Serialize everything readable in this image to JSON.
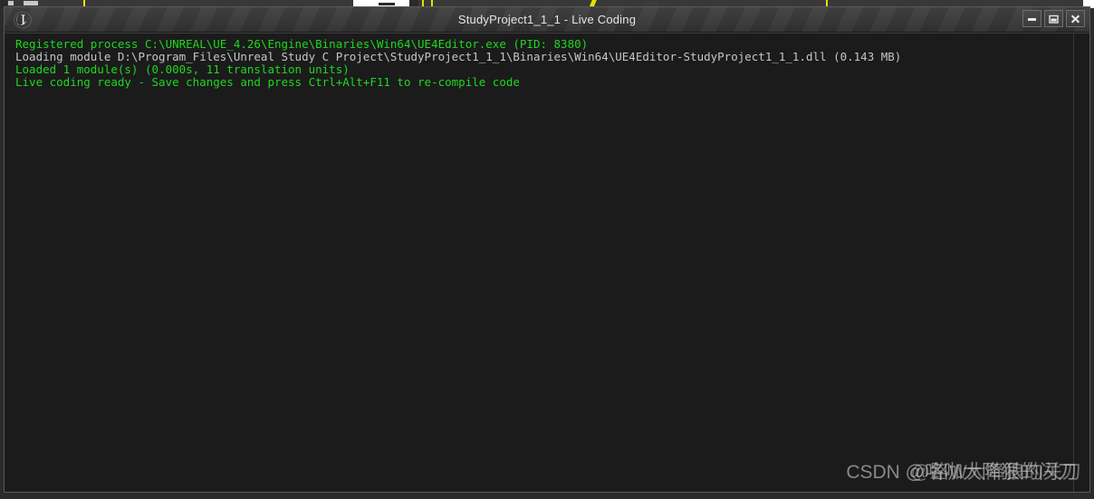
{
  "window": {
    "title": "StudyProject1_1_1 - Live Coding",
    "logo_icon": "unreal-engine-logo-icon",
    "controls": [
      {
        "name": "minimize",
        "icon": "minimize-icon",
        "label": "Minimize"
      },
      {
        "name": "maximize",
        "icon": "maximize-icon",
        "label": "Maximize"
      },
      {
        "name": "close",
        "icon": "close-icon",
        "label": "Close"
      }
    ]
  },
  "console": {
    "lines": [
      {
        "text": "Registered process C:\\UNREAL\\UE_4.26\\Engine\\Binaries\\Win64\\UE4Editor.exe (PID: 8380)",
        "color": "green"
      },
      {
        "text": "Loading module D:\\Program_Files\\Unreal Study C Project\\StudyProject1_1_1\\Binaries\\Win64\\UE4Editor-StudyProject1_1_1.dll (0.143 MB)",
        "color": "gray"
      },
      {
        "text": "Loaded 1 module(s) (0.000s, 11 translation units)",
        "color": "green"
      },
      {
        "text": "Live coding ready - Save changes and press Ctrl+Alt+F11 to re-compile code",
        "color": "green"
      }
    ],
    "colors": {
      "green": "#1ed71e",
      "gray": "#c6c6c6",
      "background": "#1b1b1b"
    }
  },
  "watermark": {
    "prefix": "CSDN ",
    "handle_front": "@咯咖大降狠的闪刀",
    "handle_back": "@路W大降狼的关刀"
  }
}
